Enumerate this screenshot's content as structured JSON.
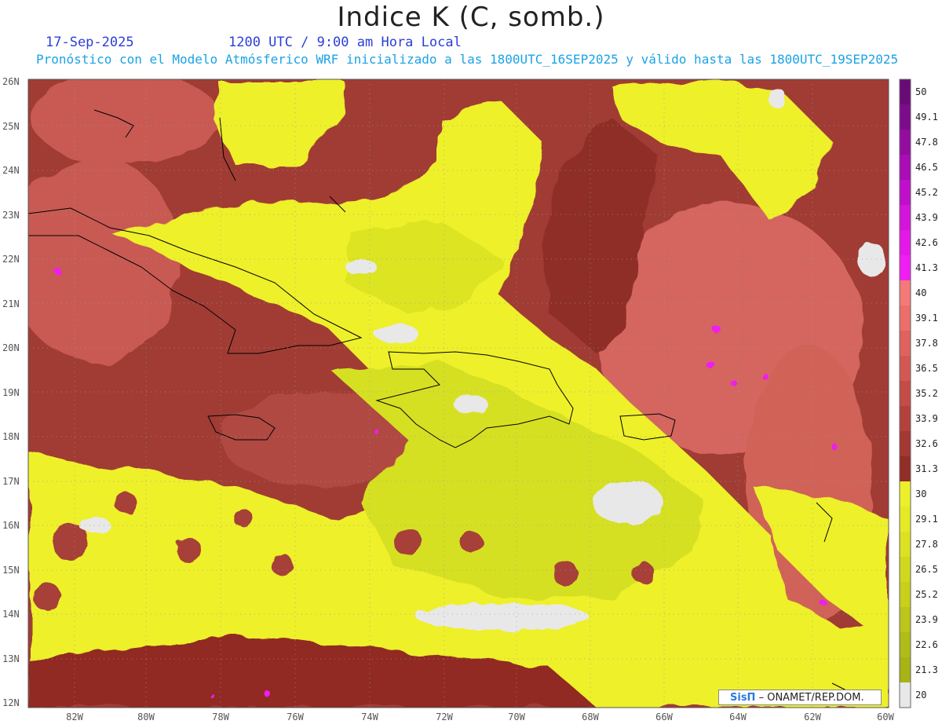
{
  "header": {
    "title": "Indice K (C, somb.)",
    "date": "17-Sep-2025",
    "time": "1200 UTC / 9:00 am Hora Local",
    "model_line": "Pronóstico con el Modelo Atmósferico WRF inicializado a las 1800UTC_16SEP2025 y válido hasta las  1800UTC_19SEP2025"
  },
  "axes": {
    "lat_labels": [
      "26N",
      "25N",
      "24N",
      "23N",
      "22N",
      "21N",
      "20N",
      "19N",
      "18N",
      "17N",
      "16N",
      "15N",
      "14N",
      "13N",
      "12N"
    ],
    "lon_labels": [
      "82W",
      "80W",
      "78W",
      "76W",
      "74W",
      "72W",
      "70W",
      "68W",
      "66W",
      "64W",
      "62W",
      "60W"
    ]
  },
  "colorbar": {
    "labels": [
      "50",
      "49.1",
      "47.8",
      "46.5",
      "45.2",
      "43.9",
      "42.6",
      "41.3",
      "40",
      "39.1",
      "37.8",
      "36.5",
      "35.2",
      "33.9",
      "32.6",
      "31.3",
      "30",
      "29.1",
      "27.8",
      "26.5",
      "25.2",
      "23.9",
      "22.6",
      "21.3",
      "20"
    ],
    "colors": [
      "#6a0a78",
      "#7e0a8c",
      "#940ca0",
      "#aa0cb6",
      "#c00fca",
      "#d414dc",
      "#e418e8",
      "#f01ef2",
      "#f47a78",
      "#ec6e6a",
      "#e0625e",
      "#d45852",
      "#c44c46",
      "#b4423c",
      "#a43832",
      "#922e28",
      "#ecf02a",
      "#e6ea26",
      "#dce222",
      "#d0d81e",
      "#c8d01c",
      "#bcc61a",
      "#b0bc18",
      "#a6b416",
      "#e8e8e8"
    ]
  },
  "credit": {
    "logo": "SisΠ",
    "text": "– ONAMET/REP.DOM."
  },
  "palette": {
    "dark_brown": "#8c2e24",
    "mid_brown": "#b04a40",
    "pink": "#dc6e66",
    "yellow": "#eef02c",
    "yellow_green": "#d8e224",
    "gray": "#e8e8e8",
    "magenta": "#f01ef2",
    "coast": "#000000"
  }
}
